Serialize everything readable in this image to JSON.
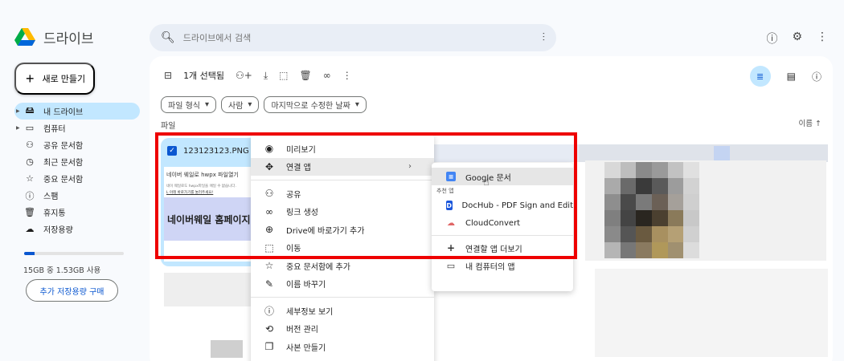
{
  "app": {
    "title": "드라이브",
    "logo_colors": [
      "#0066da",
      "#00ac47",
      "#ffba00",
      "#ea4335"
    ]
  },
  "search": {
    "placeholder": "드라이브에서 검색",
    "icon": "search-icon",
    "tune_icon": "tune-icon"
  },
  "header_icons": [
    "help-icon",
    "settings-icon",
    "more-icon"
  ],
  "sidebar": {
    "new_label": "새로 만들기",
    "items": [
      {
        "label": "내 드라이브",
        "icon": "drive-icon",
        "active": true
      },
      {
        "label": "컴퓨터",
        "icon": "computer-icon",
        "active": false
      },
      {
        "label": "공유 문서함",
        "icon": "shared-icon",
        "active": false
      },
      {
        "label": "최근 문서함",
        "icon": "recent-icon",
        "active": false
      },
      {
        "label": "중요 문서함",
        "icon": "star-icon",
        "active": false
      },
      {
        "label": "스팸",
        "icon": "spam-icon",
        "active": false
      },
      {
        "label": "휴지통",
        "icon": "trash-icon",
        "active": false
      },
      {
        "label": "저장용량",
        "icon": "cloud-icon",
        "active": false
      }
    ],
    "storage_text": "15GB 중 1.53GB 사용",
    "storage_fraction": 0.102,
    "buy_label": "추가 저장용량 구매"
  },
  "toolbar": {
    "selected_text": "1개 선택됨"
  },
  "filters": [
    {
      "label": "파일 형식"
    },
    {
      "label": "사람"
    },
    {
      "label": "마지막으로 수정한 날짜"
    }
  ],
  "section_label": "파일",
  "sort_label": "이름",
  "file": {
    "name": "123123123.PNG",
    "thumb_line1": "네이버 웨일로 hwpx 파일열기",
    "thumb_line2": "네이 웨일로도 hwpx파일을 애일 수 없습니다.",
    "thumb_line3": "L 아래 바로가기를 눌러주세요!",
    "thumb_big": "네이버웨일 홈페이지"
  },
  "context_menu": [
    {
      "label": "미리보기",
      "icon": "eye-icon"
    },
    {
      "label": "연결 앱",
      "icon": "open-with-icon",
      "submenu": true
    },
    {
      "sep": true
    },
    {
      "label": "공유",
      "icon": "person-add-icon"
    },
    {
      "label": "링크 생성",
      "icon": "link-icon"
    },
    {
      "label": "Drive에 바로가기 추가",
      "icon": "add-shortcut-icon"
    },
    {
      "label": "이동",
      "icon": "move-icon"
    },
    {
      "label": "중요 문서함에 추가",
      "icon": "star-icon"
    },
    {
      "label": "이름 바꾸기",
      "icon": "rename-icon"
    },
    {
      "sep": true
    },
    {
      "label": "세부정보 보기",
      "icon": "info-icon"
    },
    {
      "label": "버전 관리",
      "icon": "history-icon"
    },
    {
      "label": "사본 만들기",
      "icon": "copy-icon"
    }
  ],
  "open_with_submenu": {
    "primary": "Google 문서",
    "recommended_header": "추천 앱",
    "apps": [
      {
        "label": "DocHub - PDF Sign and Edit",
        "color": "#1a56db"
      },
      {
        "label": "CloudConvert",
        "color": "#e06666"
      }
    ],
    "connect_more": "연결할 앱 더보기",
    "computer_apps": "내 컴퓨터의 앱"
  },
  "highlight_color": "#ee0000"
}
